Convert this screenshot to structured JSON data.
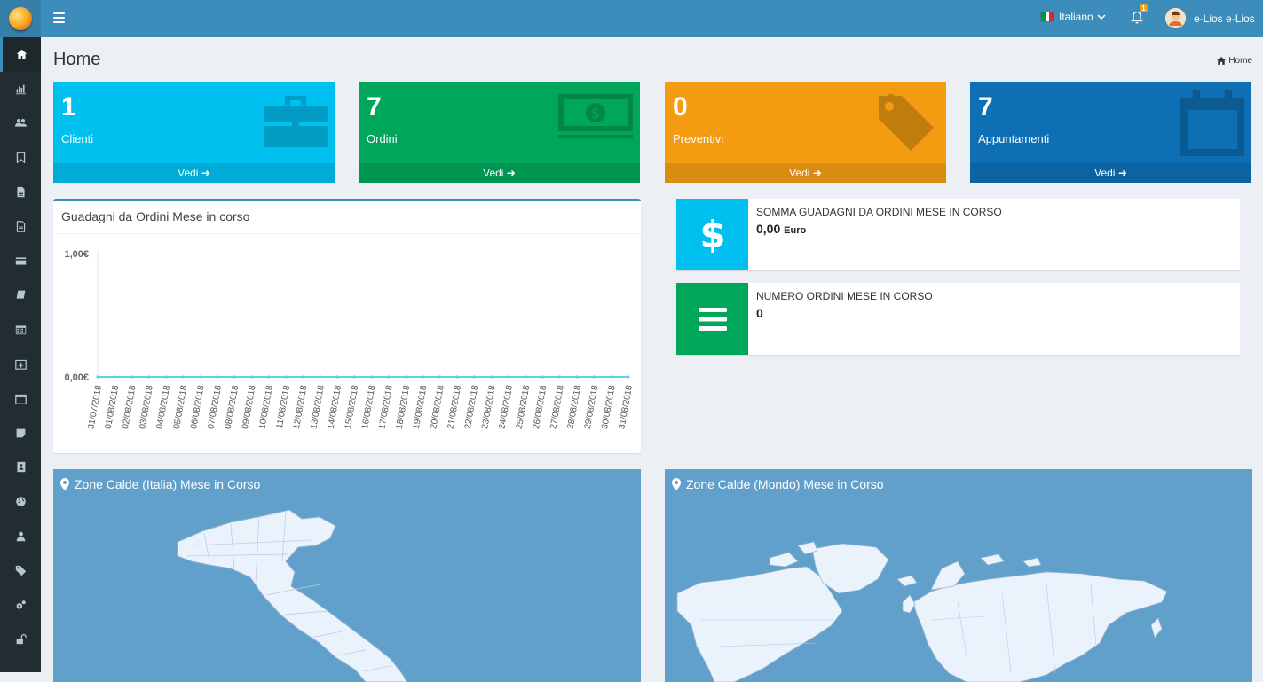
{
  "topbar": {
    "language": "Italiano",
    "notifications_count": "1",
    "user_name": "e-Lios e-Lios"
  },
  "page": {
    "title": "Home",
    "breadcrumb": "Home"
  },
  "stat_boxes": [
    {
      "value": "1",
      "label": "Clienti",
      "link": "Vedi",
      "color": "#00c0ef",
      "icon": "briefcase-icon"
    },
    {
      "value": "7",
      "label": "Ordini",
      "link": "Vedi",
      "color": "#00a65a",
      "icon": "money-icon"
    },
    {
      "value": "0",
      "label": "Preventivi",
      "link": "Vedi",
      "color": "#f39c12",
      "icon": "tags-icon"
    },
    {
      "value": "7",
      "label": "Appuntamenti",
      "link": "Vedi",
      "color": "#0f6fb4",
      "icon": "calendar-icon"
    }
  ],
  "chart_panel": {
    "title": "Guadagni da Ordini Mese in corso"
  },
  "chart_data": {
    "type": "line",
    "title": "Guadagni da Ordini Mese in corso",
    "x": [
      "31/07/2018",
      "01/08/2018",
      "02/08/2018",
      "03/08/2018",
      "04/08/2018",
      "05/08/2018",
      "06/08/2018",
      "07/08/2018",
      "08/08/2018",
      "09/08/2018",
      "10/08/2018",
      "11/08/2018",
      "12/08/2018",
      "13/08/2018",
      "14/08/2018",
      "15/08/2018",
      "16/08/2018",
      "17/08/2018",
      "18/08/2018",
      "19/08/2018",
      "20/08/2018",
      "21/08/2018",
      "22/08/2018",
      "23/08/2018",
      "24/08/2018",
      "25/08/2018",
      "26/08/2018",
      "27/08/2018",
      "28/08/2018",
      "29/08/2018",
      "30/08/2018",
      "31/08/2018"
    ],
    "series": [
      {
        "values": [
          0,
          0,
          0,
          0,
          0,
          0,
          0,
          0,
          0,
          0,
          0,
          0,
          0,
          0,
          0,
          0,
          0,
          0,
          0,
          0,
          0,
          0,
          0,
          0,
          0,
          0,
          0,
          0,
          0,
          0,
          0,
          0
        ]
      }
    ],
    "y_ticks": [
      "1,00€",
      "0,00€"
    ],
    "ylim": [
      0,
      1
    ],
    "line_color": "#5bd3e8"
  },
  "info_boxes": [
    {
      "label": "Somma guadagni da ordini mese in corso",
      "value": "0,00",
      "unit": "Euro",
      "color": "#00c0ef",
      "icon": "dollar-icon"
    },
    {
      "label": "Numero ordini mese in corso",
      "value": "0",
      "color": "#00a65a",
      "icon": "bars-icon"
    }
  ],
  "maps": [
    {
      "title": "Zone Calde (Italia) Mese in Corso",
      "icon": "map-marker-icon"
    },
    {
      "title": "Zone Calde (Mondo) Mese in Corso",
      "icon": "map-marker-icon"
    }
  ],
  "sidebar": {
    "icons": [
      "home-icon",
      "bar-chart-icon",
      "users-icon",
      "bookmark-icon",
      "file-icon",
      "file-text-icon",
      "credit-card-icon",
      "book-icon",
      "calendar-icon",
      "calendar-plus-icon",
      "calendar-o-icon",
      "sticky-note-icon",
      "address-book-icon",
      "globe-icon",
      "user-icon",
      "tags-icon",
      "cogs-icon",
      "unlock-icon"
    ]
  }
}
